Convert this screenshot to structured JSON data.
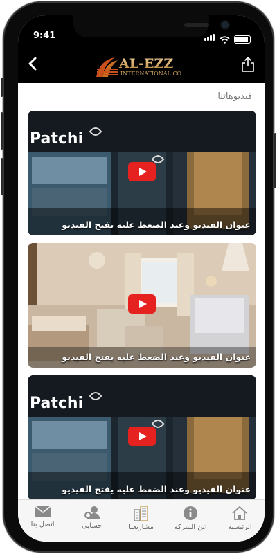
{
  "status_bar": {
    "time": "9:41"
  },
  "header": {
    "logo_title": "AL-EZZ",
    "logo_subtitle": "INTERNATIONAL CO."
  },
  "section": {
    "title": "فيديوهاتنا"
  },
  "videos": [
    {
      "caption": "عنوان الفيديو وعند الضغط عليه يفتح الفيديو",
      "sign": "Patchi"
    },
    {
      "caption": "عنوان الفيديو وعند الضغط عليه يفتح الفيديو",
      "sign": ""
    },
    {
      "caption": "عنوان الفيديو وعند الضغط عليه يفتح الفيديو",
      "sign": "Patchi"
    }
  ],
  "tabs": [
    {
      "label": "اتصل بنا",
      "icon": "envelope-icon"
    },
    {
      "label": "حسابى",
      "icon": "account-icon"
    },
    {
      "label": "مشاريعنا",
      "icon": "buildings-icon"
    },
    {
      "label": "عن الشركة",
      "icon": "info-icon"
    },
    {
      "label": "الرئيسية",
      "icon": "home-icon"
    }
  ],
  "colors": {
    "accent": "#e52220",
    "logo_gold": "#c8a064",
    "logo_orange": "#c9501a"
  }
}
